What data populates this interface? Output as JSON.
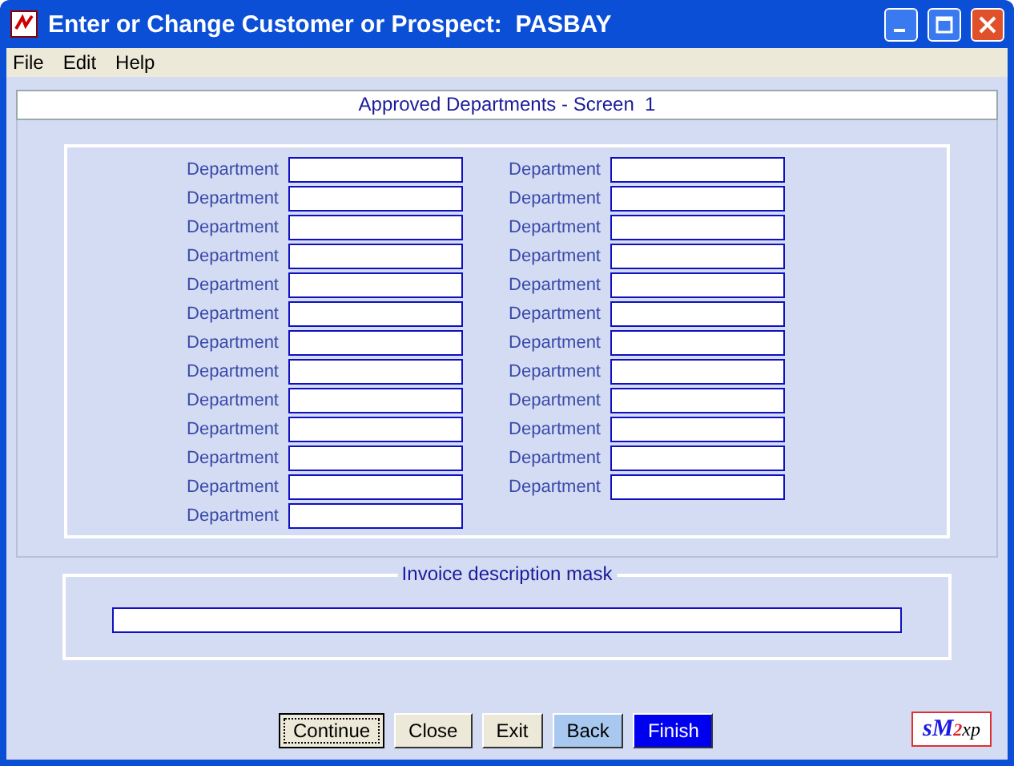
{
  "window": {
    "title": "Enter or Change Customer or Prospect:  PASBAY"
  },
  "menu": [
    "File",
    "Edit",
    "Help"
  ],
  "header": "Approved Departments - Screen  1",
  "columns": [
    [
      {
        "label": "Department"
      },
      {
        "label": "Department"
      },
      {
        "label": "Department"
      },
      {
        "label": "Department"
      },
      {
        "label": "Department"
      },
      {
        "label": "Department"
      },
      {
        "label": "Department"
      },
      {
        "label": "Department"
      },
      {
        "label": "Department"
      },
      {
        "label": "Department"
      },
      {
        "label": "Department"
      },
      {
        "label": "Department"
      },
      {
        "label": "Department"
      }
    ],
    [
      {
        "label": "Department"
      },
      {
        "label": "Department"
      },
      {
        "label": "Department"
      },
      {
        "label": "Department"
      },
      {
        "label": "Department"
      },
      {
        "label": "Department"
      },
      {
        "label": "Department"
      },
      {
        "label": "Department"
      },
      {
        "label": "Department"
      },
      {
        "label": "Department"
      },
      {
        "label": "Department"
      },
      {
        "label": "Department"
      }
    ]
  ],
  "invoice_mask": {
    "legend": "Invoice description mask"
  },
  "buttons": [
    {
      "label": "Continue",
      "kind": "focused"
    },
    {
      "label": "Close",
      "kind": "plain"
    },
    {
      "label": "Exit",
      "kind": "plain"
    },
    {
      "label": "Back",
      "kind": "light"
    },
    {
      "label": "Finish",
      "kind": "primary"
    }
  ],
  "logo": [
    "s",
    "M",
    "2",
    "xp"
  ]
}
